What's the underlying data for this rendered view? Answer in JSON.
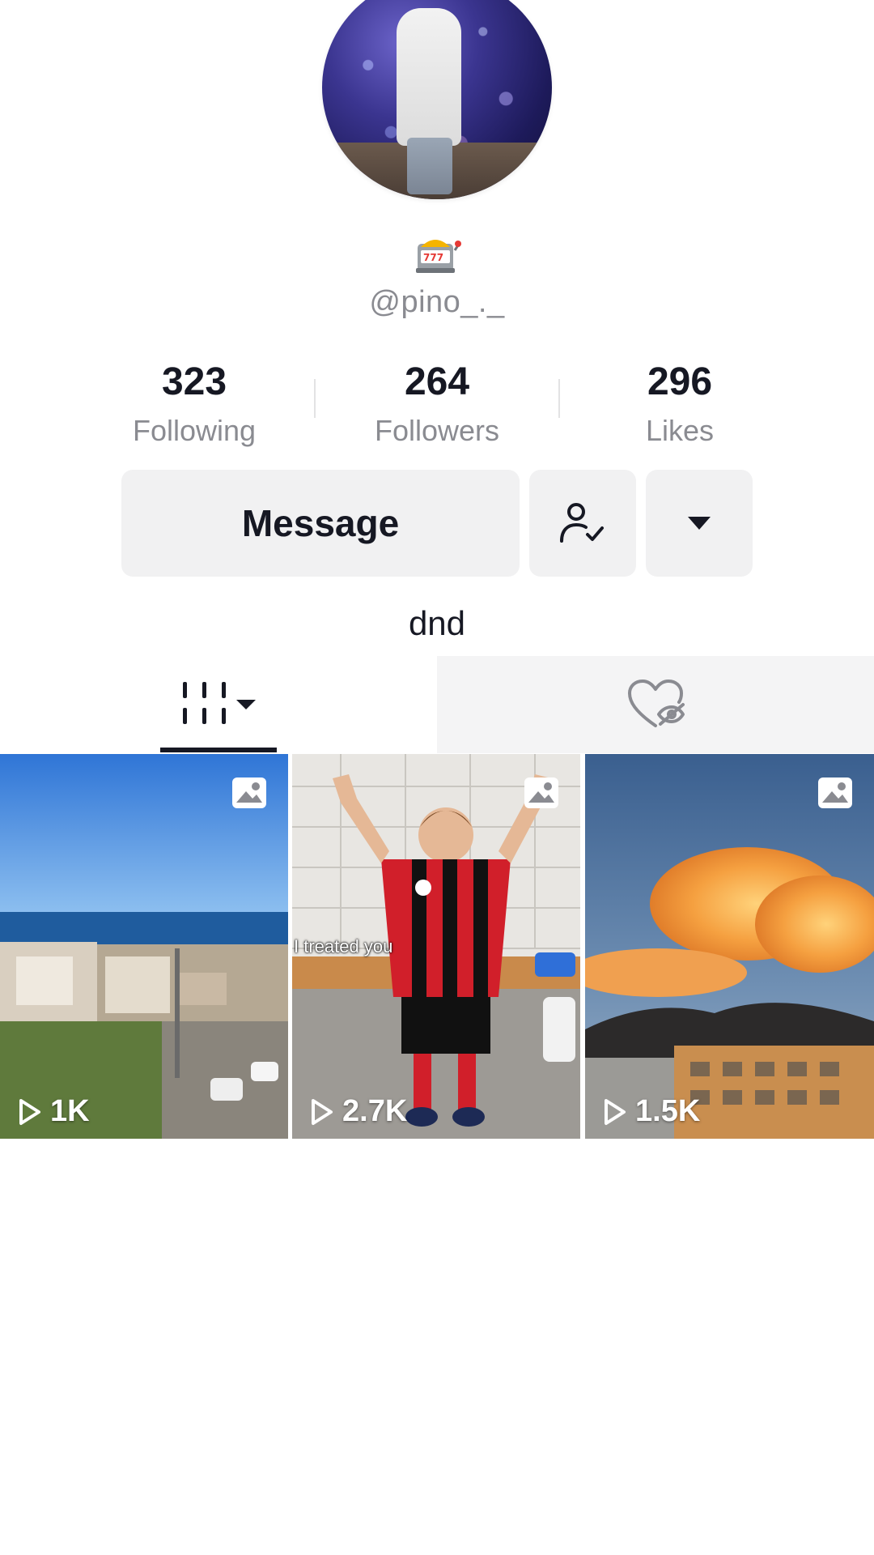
{
  "profile": {
    "username": "@pino_._",
    "bio": "dnd"
  },
  "stats": {
    "following": {
      "value": "323",
      "label": "Following"
    },
    "followers": {
      "value": "264",
      "label": "Followers"
    },
    "likes": {
      "value": "296",
      "label": "Likes"
    }
  },
  "actions": {
    "message_label": "Message"
  },
  "videos": [
    {
      "views": "1K",
      "type": "photo"
    },
    {
      "views": "2.7K",
      "type": "photo",
      "caption": "I treated you"
    },
    {
      "views": "1.5K",
      "type": "photo"
    }
  ],
  "icons": {
    "avatar": "avatar",
    "slot": "slot-machine-emoji",
    "following": "person-check-icon",
    "more": "caret-down-icon",
    "videos_tab": "grid-sort-icon",
    "liked_tab": "heart-hidden-icon",
    "photo": "photo-icon",
    "play": "play-icon"
  },
  "colors": {
    "text_primary": "#161823",
    "text_secondary": "#8a8b91",
    "button_bg": "#f1f1f2"
  }
}
